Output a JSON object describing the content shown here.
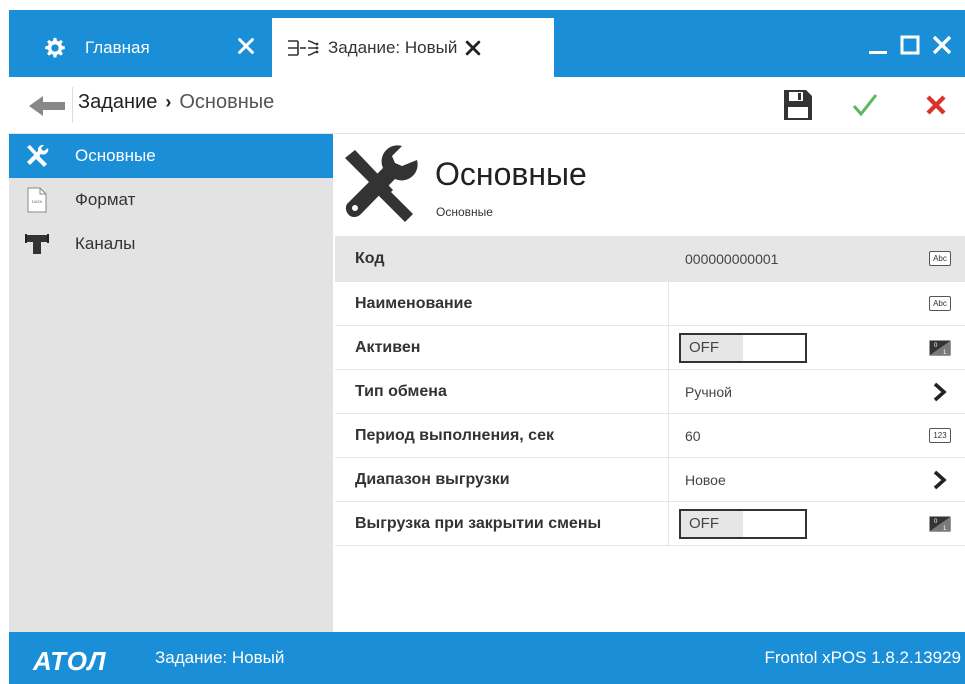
{
  "tabs": [
    {
      "label": "Главная",
      "icon": "gear-icon"
    },
    {
      "label": "Задание: Новый",
      "icon": "exchange-icon"
    }
  ],
  "toolbar": {
    "breadcrumb_root": "Задание",
    "breadcrumb_sep": "›",
    "breadcrumb_current": "Основные"
  },
  "sidebar": {
    "items": [
      {
        "label": "Основные",
        "icon": "tools-icon",
        "active": true
      },
      {
        "label": "Формат",
        "icon": "data-file-icon",
        "active": false
      },
      {
        "label": "Каналы",
        "icon": "pipe-icon",
        "active": false
      }
    ]
  },
  "header": {
    "title": "Основные",
    "subtitle": "Основные"
  },
  "fields": [
    {
      "label": "Код",
      "value": "000000000001",
      "icon": "Abc"
    },
    {
      "label": "Наименование",
      "value": "",
      "icon": "Abc"
    },
    {
      "label": "Активен",
      "value": "OFF",
      "icon": "toggle-icon"
    },
    {
      "label": "Тип обмена",
      "value": "Ручной",
      "icon": "chevron-right-icon"
    },
    {
      "label": "Период выполнения, сек",
      "value": "60",
      "icon": "123"
    },
    {
      "label": "Диапазон выгрузки",
      "value": "Новое",
      "icon": "chevron-right-icon"
    },
    {
      "label": "Выгрузка при закрытии смены",
      "value": "OFF",
      "icon": "toggle-icon"
    }
  ],
  "statusbar": {
    "logo": "АТОЛ",
    "text": "Задание: Новый",
    "version": "Frontol xPOS 1.8.2.13929"
  },
  "colors": {
    "accent": "#1a8fd8",
    "ok": "#5cb85c",
    "cancel": "#d9342b"
  }
}
